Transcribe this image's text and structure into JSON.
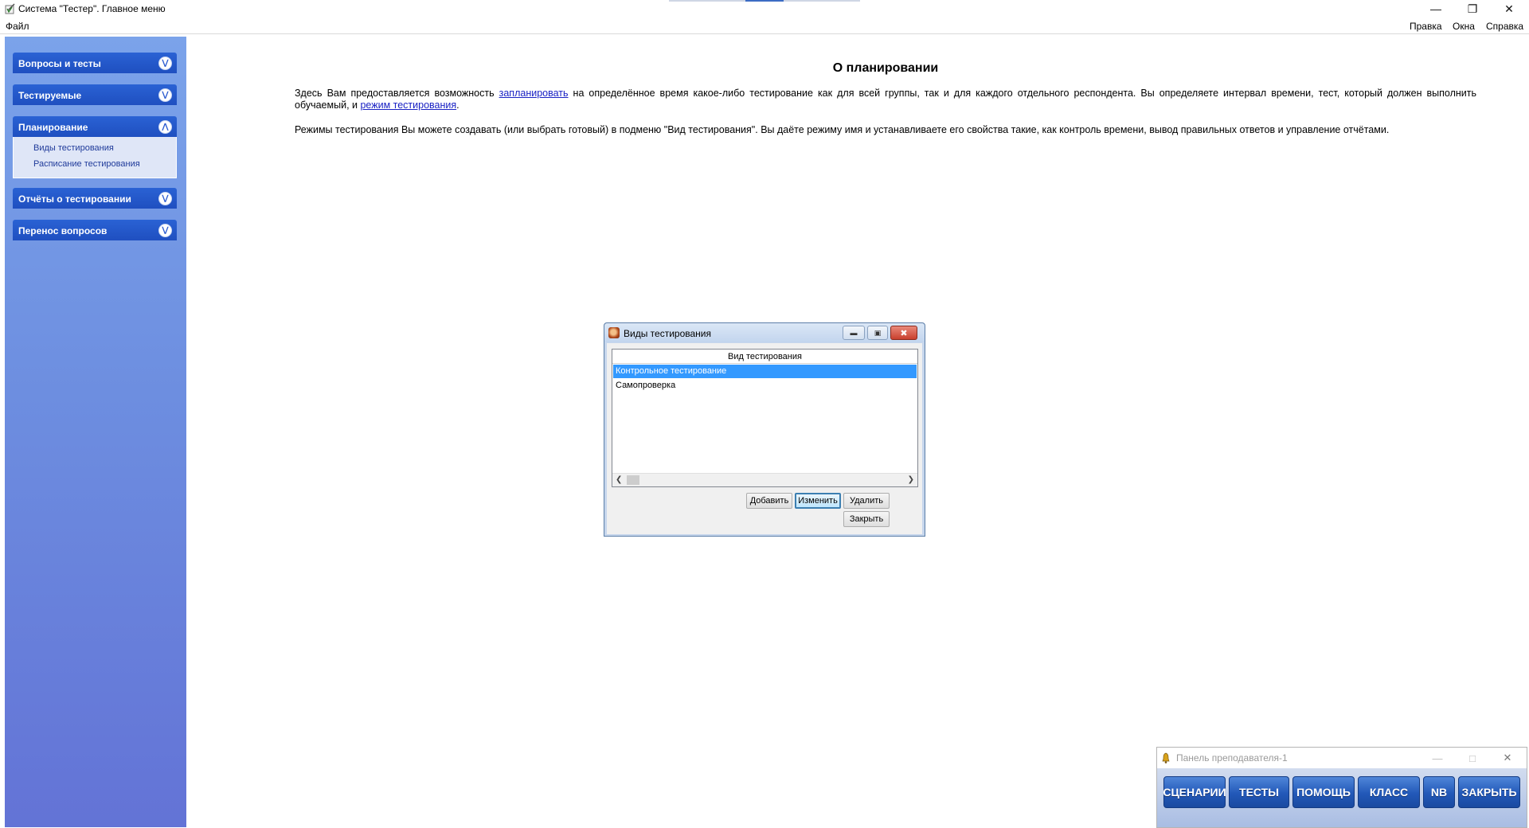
{
  "window": {
    "title": "Система \"Тестер\". Главное меню"
  },
  "menu": {
    "file": "Файл",
    "edit": "Правка",
    "windows": "Окна",
    "help": "Справка"
  },
  "sidebar": {
    "sections": [
      {
        "label": "Вопросы и тесты",
        "expanded": false
      },
      {
        "label": "Тестируемые",
        "expanded": false
      },
      {
        "label": "Планирование",
        "expanded": true,
        "items": [
          "Виды тестирования",
          "Расписание тестирования"
        ]
      },
      {
        "label": "Отчёты о тестировании",
        "expanded": false
      },
      {
        "label": "Перенос вопросов",
        "expanded": false
      }
    ]
  },
  "content": {
    "title": "О планировании",
    "p1_a": "Здесь Вам предоставляется возможность ",
    "p1_link1": "запланировать",
    "p1_b": " на определённое время какое-либо тестирование как для всей группы, так и для каждого отдельного респондента. Вы определяете интервал времени, тест, который должен выполнить обучаемый, и ",
    "p1_link2": "режим тестирования",
    "p1_c": ".",
    "p2": "Режимы тестирования Вы можете создавать (или выбрать готовый) в подменю \"Вид тестирования\". Вы даёте режиму имя и устанавливаете его свойства такие, как контроль времени, вывод правильных ответов и управление отчётами."
  },
  "dialog": {
    "title": "Виды тестирования",
    "column_header": "Вид тестирования",
    "rows": [
      "Контрольное тестирование",
      "Самопроверка"
    ],
    "selected_row": 0,
    "buttons": {
      "add": "Добавить",
      "edit": "Изменить",
      "delete": "Удалить",
      "close": "Закрыть"
    }
  },
  "teacher_panel": {
    "title": "Панель преподавателя-1",
    "buttons": [
      "СЦЕНАРИИ",
      "ТЕСТЫ",
      "ПОМОЩЬ",
      "КЛАСС",
      "NB",
      "ЗАКРЫТЬ"
    ]
  },
  "colors": {
    "sidebar_header": "#2a62d4",
    "sidebar_bg": "#6d8ee0",
    "link": "#1a22c4",
    "selection": "#3399ff",
    "panel_button": "#2258b8"
  }
}
